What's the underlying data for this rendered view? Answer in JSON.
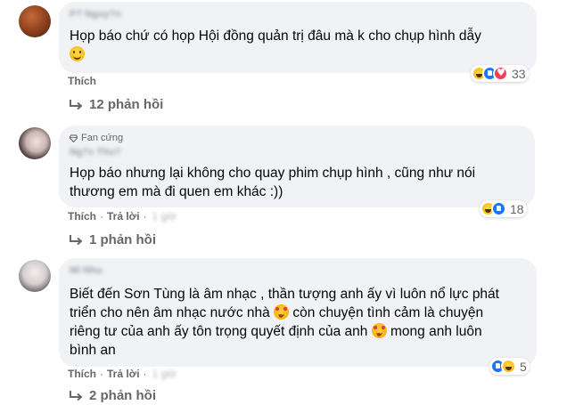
{
  "comments": [
    {
      "author": "P? Nguy?n",
      "badge": "",
      "author_line2": "",
      "text_lines": [
        "Họp báo chứ có họp Hội đồng quản trị đâu mà k cho chụp hình dẫy"
      ],
      "trailing_emoji": "smile-emoji",
      "like_label": "Thích",
      "reply_label": "",
      "time": "",
      "reactions": [
        "haha",
        "like",
        "love"
      ],
      "reaction_count": "33",
      "replies_label": "12 phản hồi"
    },
    {
      "author": "",
      "badge": "Fan cứng",
      "author_line2": "Ng?c Thu?",
      "text_lines": [
        "Họp báo nhưng lại không cho quay phim chụp hình , cũng như nói",
        "thương em mà đi quen em khác :))"
      ],
      "like_label": "Thích",
      "reply_label": "Trả lời",
      "time": "1 giờ",
      "reactions": [
        "haha",
        "like"
      ],
      "reaction_count": "18",
      "replies_label": "1 phản hồi"
    },
    {
      "author": "Mi Nhu",
      "badge": "",
      "author_line2": "",
      "text_lines": [
        "Biết đến Sơn Tùng là âm nhạc , thần tượng anh ấy vì luôn nổ lực phát",
        "triển cho nên âm nhạc nước nhà",
        "còn chuyện tình cảm là chuyện",
        "riêng tư của anh ấy tôn trọng quyết định của anh",
        "mong anh luôn",
        "bình an"
      ],
      "like_label": "Thích",
      "reply_label": "Trả lời",
      "time": "1 giờ",
      "reactions": [
        "like",
        "haha"
      ],
      "reaction_count": "5",
      "replies_label": "2 phản hồi"
    }
  ],
  "colors": {
    "bubble": "#f0f2f5",
    "muted": "#65676b",
    "text": "#050505",
    "like_blue": "#1877f2",
    "love_red": "#f33e58"
  }
}
